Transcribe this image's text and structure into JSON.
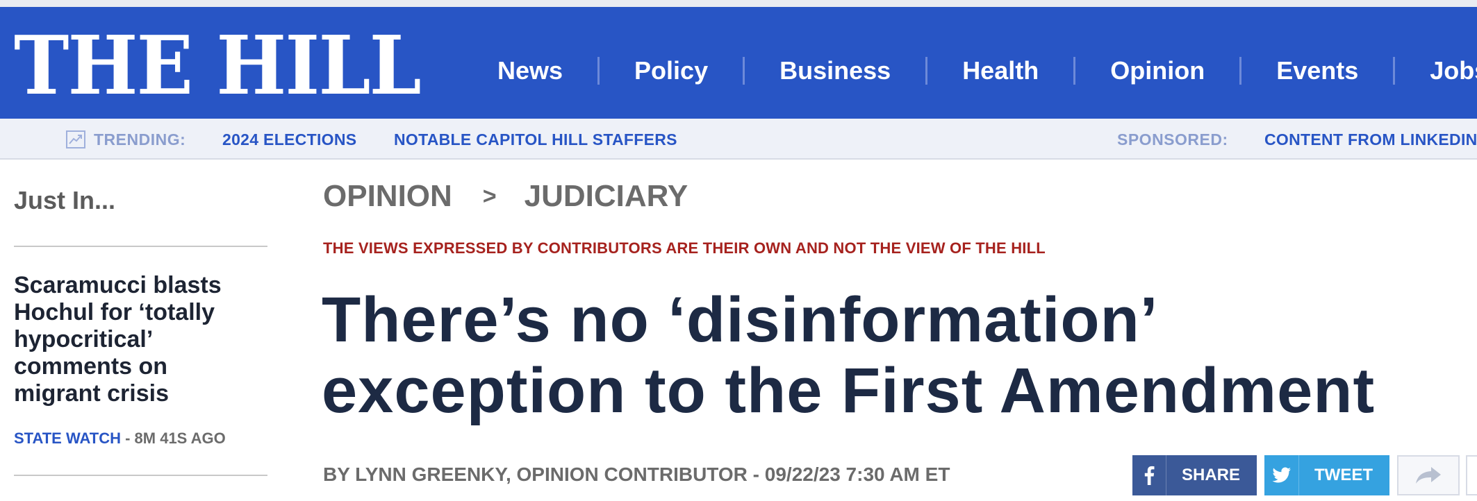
{
  "masthead": {
    "logo": "THE HILL",
    "nav": [
      "News",
      "Policy",
      "Business",
      "Health",
      "Opinion",
      "Events",
      "Jobs"
    ]
  },
  "trending": {
    "label": "TRENDING:",
    "links": [
      "2024 ELECTIONS",
      "NOTABLE CAPITOL HILL STAFFERS"
    ],
    "sponsored_label": "SPONSORED:",
    "sponsored_link": "CONTENT FROM LINKEDIN"
  },
  "sidebar": {
    "title": "Just In...",
    "items": [
      {
        "headline": "Scaramucci blasts Hochul for ‘totally hypocritical’ comments on migrant crisis",
        "tag": "STATE WATCH",
        "time": " - 8M 41S AGO"
      }
    ]
  },
  "article": {
    "breadcrumb": [
      "OPINION",
      "JUDICIARY"
    ],
    "breadcrumb_sep": ">",
    "disclaimer": "THE VIEWS EXPRESSED BY CONTRIBUTORS ARE THEIR OWN AND NOT THE VIEW OF THE HILL",
    "headline": "There’s no ‘disinformation’ exception to the First Amendment",
    "byline": "BY LYNN GREENKY, OPINION CONTRIBUTOR - 09/22/23 7:30 AM ET"
  },
  "share": {
    "facebook_label": "SHARE",
    "twitter_label": "TWEET",
    "icons": [
      "facebook-icon",
      "twitter-icon",
      "forward-icon"
    ]
  },
  "colors": {
    "brand_blue": "#2855c5",
    "disclaimer_red": "#a6221e",
    "headline_navy": "#1d2a44",
    "facebook": "#3b5998",
    "twitter": "#35a2e0"
  }
}
